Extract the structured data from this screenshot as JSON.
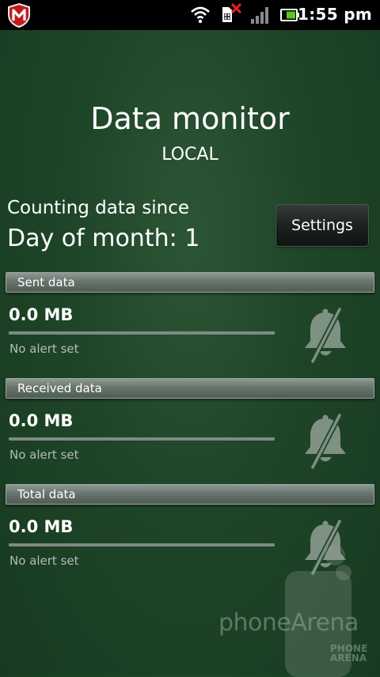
{
  "status_bar": {
    "time": "1:55 pm",
    "app_icon": "mcafee-icon",
    "icons": [
      "wifi-icon",
      "sim-card-missing-icon",
      "signal-icon",
      "battery-icon"
    ]
  },
  "header": {
    "title": "Data monitor",
    "subtitle": "LOCAL"
  },
  "period": {
    "label": "Counting data since",
    "value": "Day of month: 1"
  },
  "settings_button": {
    "label": "Settings"
  },
  "sections": [
    {
      "title": "Sent data",
      "value": "0.0 MB",
      "usage_fraction": 0,
      "alert": "No alert set",
      "icon": "bell-off-icon"
    },
    {
      "title": "Received data",
      "value": "0.0 MB",
      "usage_fraction": 0,
      "alert": "No alert set",
      "icon": "bell-off-icon"
    },
    {
      "title": "Total data",
      "value": "0.0 MB",
      "usage_fraction": 0,
      "alert": "No alert set",
      "icon": "bell-off-icon"
    }
  ],
  "watermark": {
    "text": "phoneArena",
    "line1": "PHONE",
    "line2": "ARENA"
  },
  "colors": {
    "background": "#1f4528",
    "section_header": "#6e7a73",
    "bell_icon": "#8a9a8e",
    "status_bar": "#000000"
  }
}
